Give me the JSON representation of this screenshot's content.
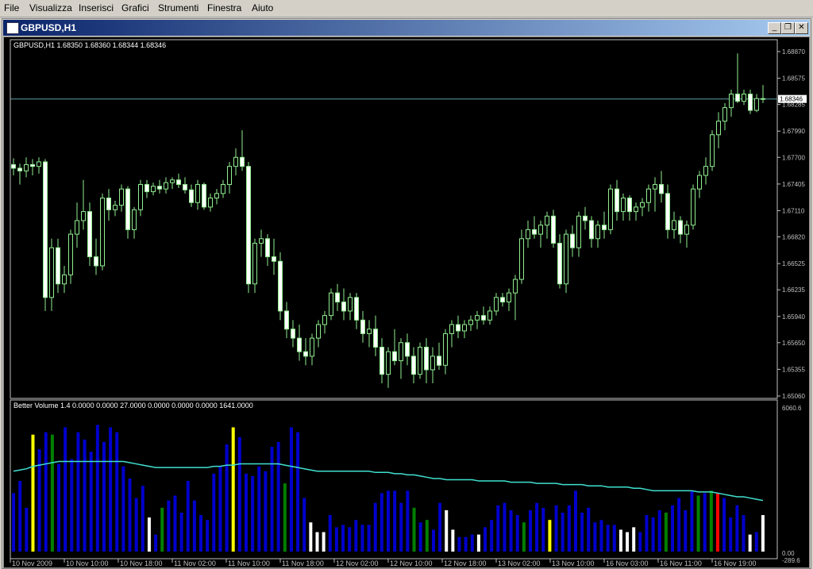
{
  "menu": [
    "File",
    "Visualizza",
    "Inserisci",
    "Grafici",
    "Strumenti",
    "Finestra",
    "Aiuto"
  ],
  "window": {
    "title": "GBPUSD,H1",
    "icon": "chart-window-icon",
    "buttons": [
      "minimize-icon",
      "restore-icon",
      "close-icon"
    ]
  },
  "price_panel": {
    "header": "GBPUSD,H1  1.68350 1.68360 1.68344 1.68346",
    "price_labels": [
      "1.68870",
      "1.68575",
      "1.68285",
      "1.67990",
      "1.67700",
      "1.67405",
      "1.67110",
      "1.66820",
      "1.66525",
      "1.66235",
      "1.65940",
      "1.65650",
      "1.65355",
      "1.65060"
    ],
    "current_price": "1.68346"
  },
  "volume_panel": {
    "header": "Better Volume 1.4 0.0000 0.0000 27.0000 0.0000 0.0000 0.0000 1641.0000",
    "top_label": "6060.6",
    "bottom_label_1": "0.00",
    "bottom_label_2": "-289.6"
  },
  "time_labels": [
    "10 Nov 2009",
    "10 Nov 10:00",
    "10 Nov 18:00",
    "11 Nov 02:00",
    "11 Nov 10:00",
    "11 Nov 18:00",
    "12 Nov 02:00",
    "12 Nov 10:00",
    "12 Nov 18:00",
    "13 Nov 02:00",
    "13 Nov 10:00",
    "16 Nov 03:00",
    "16 Nov 11:00",
    "16 Nov 19:00"
  ],
  "colors": {
    "candle": "#90ee90",
    "candle_body_up": "#000000",
    "candle_body_down": "#ffffff",
    "ma": "#40e0d0",
    "vol_blue": "#0000cd",
    "vol_green": "#008000",
    "vol_yellow": "#ffff00",
    "vol_white": "#ffffff",
    "vol_red": "#ff0000",
    "grid_axis": "#c0c0c0"
  },
  "chart_data": [
    {
      "type": "candlestick",
      "title": "GBPUSD,H1",
      "ylim": [
        1.6506,
        1.6887
      ],
      "ohlc": [
        [
          1.6762,
          1.6769,
          1.675,
          1.6758
        ],
        [
          1.6758,
          1.6763,
          1.674,
          1.6755
        ],
        [
          1.6755,
          1.677,
          1.6748,
          1.6762
        ],
        [
          1.6762,
          1.6768,
          1.675,
          1.676
        ],
        [
          1.676,
          1.677,
          1.6752,
          1.6765
        ],
        [
          1.6765,
          1.6768,
          1.66,
          1.6615
        ],
        [
          1.6615,
          1.668,
          1.66,
          1.667
        ],
        [
          1.667,
          1.668,
          1.662,
          1.663
        ],
        [
          1.663,
          1.665,
          1.662,
          1.664
        ],
        [
          1.664,
          1.669,
          1.663,
          1.6685
        ],
        [
          1.6685,
          1.672,
          1.667,
          1.67
        ],
        [
          1.67,
          1.6745,
          1.669,
          1.671
        ],
        [
          1.671,
          1.672,
          1.665,
          1.666
        ],
        [
          1.666,
          1.668,
          1.664,
          1.665
        ],
        [
          1.665,
          1.673,
          1.6645,
          1.6725
        ],
        [
          1.6725,
          1.6735,
          1.67,
          1.6712
        ],
        [
          1.6712,
          1.6722,
          1.6705,
          1.6717
        ],
        [
          1.6717,
          1.674,
          1.671,
          1.6735
        ],
        [
          1.6735,
          1.6738,
          1.668,
          1.669
        ],
        [
          1.669,
          1.6715,
          1.668,
          1.6712
        ],
        [
          1.6712,
          1.6745,
          1.6705,
          1.674
        ],
        [
          1.674,
          1.6745,
          1.6725,
          1.6732
        ],
        [
          1.6732,
          1.6742,
          1.6728,
          1.6738
        ],
        [
          1.6738,
          1.6745,
          1.673,
          1.6735
        ],
        [
          1.6735,
          1.6748,
          1.673,
          1.6742
        ],
        [
          1.6742,
          1.6748,
          1.6735,
          1.6745
        ],
        [
          1.6745,
          1.6752,
          1.6736,
          1.674
        ],
        [
          1.674,
          1.6748,
          1.673,
          1.6734
        ],
        [
          1.6734,
          1.674,
          1.6715,
          1.672
        ],
        [
          1.672,
          1.6745,
          1.6712,
          1.674
        ],
        [
          1.674,
          1.6742,
          1.6712,
          1.6715
        ],
        [
          1.6715,
          1.673,
          1.671,
          1.6725
        ],
        [
          1.6725,
          1.6735,
          1.6718,
          1.673
        ],
        [
          1.673,
          1.6745,
          1.6725,
          1.674
        ],
        [
          1.674,
          1.6765,
          1.673,
          1.676
        ],
        [
          1.676,
          1.678,
          1.675,
          1.677
        ],
        [
          1.677,
          1.68,
          1.6755,
          1.676
        ],
        [
          1.676,
          1.6765,
          1.662,
          1.663
        ],
        [
          1.663,
          1.668,
          1.662,
          1.6675
        ],
        [
          1.6675,
          1.669,
          1.666,
          1.668
        ],
        [
          1.668,
          1.6685,
          1.665,
          1.666
        ],
        [
          1.666,
          1.668,
          1.664,
          1.6655
        ],
        [
          1.6655,
          1.6665,
          1.659,
          1.66
        ],
        [
          1.66,
          1.661,
          1.657,
          1.658
        ],
        [
          1.658,
          1.659,
          1.656,
          1.657
        ],
        [
          1.657,
          1.6585,
          1.6545,
          1.6555
        ],
        [
          1.6555,
          1.657,
          1.654,
          1.655
        ],
        [
          1.655,
          1.6575,
          1.654,
          1.657
        ],
        [
          1.657,
          1.659,
          1.656,
          1.6585
        ],
        [
          1.6585,
          1.66,
          1.6575,
          1.6595
        ],
        [
          1.6595,
          1.6625,
          1.659,
          1.662
        ],
        [
          1.662,
          1.663,
          1.66,
          1.661
        ],
        [
          1.661,
          1.6625,
          1.659,
          1.66
        ],
        [
          1.66,
          1.662,
          1.659,
          1.6615
        ],
        [
          1.6615,
          1.662,
          1.658,
          1.659
        ],
        [
          1.659,
          1.66,
          1.6565,
          1.6575
        ],
        [
          1.6575,
          1.659,
          1.656,
          1.658
        ],
        [
          1.658,
          1.6595,
          1.655,
          1.656
        ],
        [
          1.656,
          1.657,
          1.652,
          1.653
        ],
        [
          1.653,
          1.656,
          1.6515,
          1.6555
        ],
        [
          1.6555,
          1.658,
          1.654,
          1.6545
        ],
        [
          1.6545,
          1.657,
          1.6525,
          1.6565
        ],
        [
          1.6565,
          1.6575,
          1.654,
          1.655
        ],
        [
          1.655,
          1.656,
          1.652,
          1.653
        ],
        [
          1.653,
          1.6565,
          1.6525,
          1.656
        ],
        [
          1.656,
          1.657,
          1.652,
          1.6535
        ],
        [
          1.6535,
          1.656,
          1.652,
          1.655
        ],
        [
          1.655,
          1.6565,
          1.6535,
          1.654
        ],
        [
          1.654,
          1.658,
          1.653,
          1.6575
        ],
        [
          1.6575,
          1.659,
          1.656,
          1.6585
        ],
        [
          1.6585,
          1.6595,
          1.657,
          1.6578
        ],
        [
          1.6578,
          1.659,
          1.657,
          1.6585
        ],
        [
          1.6585,
          1.6595,
          1.6578,
          1.659
        ],
        [
          1.659,
          1.66,
          1.658,
          1.6595
        ],
        [
          1.6595,
          1.6605,
          1.6585,
          1.659
        ],
        [
          1.659,
          1.6605,
          1.6585,
          1.66
        ],
        [
          1.66,
          1.662,
          1.6595,
          1.6615
        ],
        [
          1.6615,
          1.662,
          1.6605,
          1.661
        ],
        [
          1.661,
          1.6625,
          1.66,
          1.662
        ],
        [
          1.662,
          1.664,
          1.659,
          1.6635
        ],
        [
          1.6635,
          1.669,
          1.663,
          1.668
        ],
        [
          1.668,
          1.67,
          1.667,
          1.669
        ],
        [
          1.669,
          1.6705,
          1.668,
          1.6685
        ],
        [
          1.6685,
          1.67,
          1.667,
          1.6695
        ],
        [
          1.6695,
          1.671,
          1.668,
          1.6705
        ],
        [
          1.6705,
          1.6712,
          1.667,
          1.6675
        ],
        [
          1.6675,
          1.6685,
          1.6625,
          1.663
        ],
        [
          1.663,
          1.669,
          1.662,
          1.6685
        ],
        [
          1.6685,
          1.6695,
          1.666,
          1.667
        ],
        [
          1.667,
          1.671,
          1.666,
          1.6705
        ],
        [
          1.6705,
          1.6715,
          1.669,
          1.67
        ],
        [
          1.67,
          1.6705,
          1.667,
          1.668
        ],
        [
          1.668,
          1.67,
          1.667,
          1.6695
        ],
        [
          1.6695,
          1.671,
          1.668,
          1.669
        ],
        [
          1.669,
          1.674,
          1.6685,
          1.6735
        ],
        [
          1.6735,
          1.6745,
          1.67,
          1.671
        ],
        [
          1.671,
          1.673,
          1.67,
          1.6725
        ],
        [
          1.6725,
          1.6728,
          1.67,
          1.671
        ],
        [
          1.671,
          1.672,
          1.67,
          1.6715
        ],
        [
          1.6715,
          1.6725,
          1.6705,
          1.672
        ],
        [
          1.672,
          1.674,
          1.671,
          1.6735
        ],
        [
          1.6735,
          1.6748,
          1.671,
          1.674
        ],
        [
          1.674,
          1.6755,
          1.672,
          1.673
        ],
        [
          1.673,
          1.674,
          1.668,
          1.669
        ],
        [
          1.669,
          1.671,
          1.668,
          1.67
        ],
        [
          1.67,
          1.6705,
          1.6675,
          1.6685
        ],
        [
          1.6685,
          1.67,
          1.667,
          1.6695
        ],
        [
          1.6695,
          1.674,
          1.669,
          1.6735
        ],
        [
          1.6735,
          1.6755,
          1.6725,
          1.675
        ],
        [
          1.675,
          1.677,
          1.674,
          1.676
        ],
        [
          1.676,
          1.68,
          1.6755,
          1.6795
        ],
        [
          1.6795,
          1.682,
          1.678,
          1.681
        ],
        [
          1.681,
          1.683,
          1.68,
          1.6825
        ],
        [
          1.6825,
          1.6845,
          1.6815,
          1.684
        ],
        [
          1.684,
          1.6885,
          1.683,
          1.6832
        ],
        [
          1.6832,
          1.6845,
          1.6828,
          1.684
        ],
        [
          1.684,
          1.6845,
          1.6818,
          1.6822
        ],
        [
          1.6822,
          1.684,
          1.682,
          1.6835
        ],
        [
          1.6835,
          1.685,
          1.683,
          1.68346
        ]
      ]
    },
    {
      "type": "bar",
      "title": "Better Volume 1.4",
      "ylim": [
        -289.6,
        6060.6
      ],
      "values": [
        2400,
        2900,
        1800,
        4800,
        4200,
        4900,
        4800,
        3600,
        5100,
        3800,
        4900,
        4600,
        4100,
        5200,
        4500,
        5100,
        4900,
        3500,
        3000,
        2200,
        2700,
        1400,
        700,
        1800,
        2100,
        2300,
        1600,
        2900,
        2100,
        1500,
        1300,
        3200,
        3500,
        4400,
        5100,
        4700,
        3200,
        3100,
        3500,
        3300,
        4300,
        4500,
        2800,
        5100,
        4900,
        2200,
        1200,
        800,
        800,
        1500,
        1000,
        1100,
        1000,
        1300,
        1100,
        1100,
        2000,
        2400,
        2500,
        2500,
        2000,
        2500,
        1800,
        1200,
        1300,
        900,
        2000,
        1700,
        900,
        600,
        600,
        700,
        700,
        1000,
        1300,
        1900,
        2000,
        1700,
        1500,
        1200,
        1700,
        2000,
        1800,
        1300,
        1900,
        1600,
        1900,
        2500,
        1600,
        1800,
        1200,
        1300,
        1100,
        1100,
        900,
        800,
        1000,
        800,
        1500,
        1400,
        1700,
        1600,
        1900,
        2200,
        1700,
        2500,
        2300,
        2400,
        2500,
        2400,
        2200,
        1400,
        1900,
        1500,
        700,
        800,
        1500
      ],
      "bar_colors": [
        "blue",
        "blue",
        "blue",
        "yellow",
        "blue",
        "blue",
        "green",
        "blue",
        "blue",
        "blue",
        "blue",
        "blue",
        "blue",
        "blue",
        "blue",
        "blue",
        "blue",
        "blue",
        "blue",
        "blue",
        "blue",
        "white",
        "blue",
        "green",
        "blue",
        "blue",
        "blue",
        "blue",
        "blue",
        "blue",
        "blue",
        "blue",
        "blue",
        "blue",
        "yellow",
        "blue",
        "blue",
        "blue",
        "blue",
        "blue",
        "blue",
        "blue",
        "green",
        "blue",
        "blue",
        "blue",
        "white",
        "white",
        "white",
        "blue",
        "blue",
        "blue",
        "blue",
        "blue",
        "blue",
        "blue",
        "blue",
        "blue",
        "blue",
        "blue",
        "blue",
        "blue",
        "green",
        "blue",
        "green",
        "blue",
        "blue",
        "white",
        "white",
        "blue",
        "blue",
        "blue",
        "white",
        "blue",
        "blue",
        "blue",
        "blue",
        "blue",
        "blue",
        "green",
        "blue",
        "blue",
        "blue",
        "yellow",
        "blue",
        "blue",
        "blue",
        "blue",
        "blue",
        "blue",
        "blue",
        "blue",
        "blue",
        "blue",
        "white",
        "white",
        "white",
        "blue",
        "blue",
        "blue",
        "blue",
        "green",
        "blue",
        "blue",
        "blue",
        "blue",
        "green",
        "blue",
        "green",
        "red",
        "blue",
        "blue",
        "blue",
        "blue",
        "white",
        "blue",
        "white"
      ],
      "ma_values": [
        3300,
        3350,
        3400,
        3500,
        3550,
        3600,
        3650,
        3700,
        3700,
        3700,
        3700,
        3700,
        3700,
        3700,
        3700,
        3700,
        3700,
        3700,
        3650,
        3600,
        3550,
        3500,
        3450,
        3450,
        3450,
        3450,
        3450,
        3450,
        3450,
        3450,
        3450,
        3500,
        3500,
        3550,
        3550,
        3600,
        3600,
        3600,
        3600,
        3600,
        3600,
        3600,
        3550,
        3500,
        3450,
        3400,
        3350,
        3300,
        3300,
        3300,
        3300,
        3300,
        3300,
        3300,
        3300,
        3300,
        3250,
        3250,
        3250,
        3200,
        3200,
        3150,
        3150,
        3100,
        3050,
        3000,
        3000,
        2950,
        2950,
        2950,
        2950,
        2950,
        2900,
        2900,
        2900,
        2900,
        2900,
        2850,
        2850,
        2850,
        2850,
        2800,
        2800,
        2800,
        2800,
        2750,
        2750,
        2750,
        2750,
        2700,
        2700,
        2700,
        2650,
        2650,
        2650,
        2650,
        2600,
        2600,
        2550,
        2500,
        2500,
        2500,
        2500,
        2500,
        2500,
        2500,
        2450,
        2450,
        2450,
        2400,
        2350,
        2300,
        2250,
        2250,
        2200,
        2150,
        2100
      ],
      "current_value": 1641.0
    }
  ]
}
